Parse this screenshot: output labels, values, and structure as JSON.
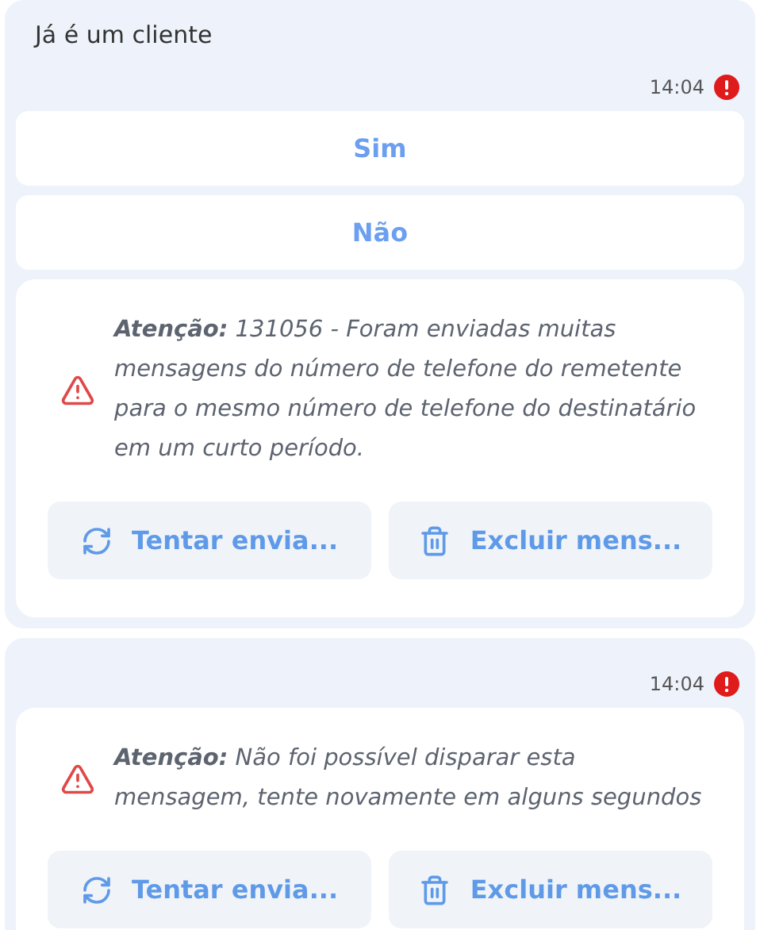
{
  "messages": [
    {
      "text": "Já é um cliente",
      "time": "14:04",
      "error": true,
      "options": [
        "Sim",
        "Não"
      ],
      "alert": {
        "text": "**Atenção:** 131056 - Foram enviadas muitas mensagens do número de telefone do remetente para o mesmo número de telefone do destinatário em um curto período.",
        "actions": [
          {
            "kind": "retry",
            "label": "Tentar envia..."
          },
          {
            "kind": "delete",
            "label": "Excluir mens..."
          }
        ]
      }
    },
    {
      "time": "14:04",
      "error": true,
      "alert": {
        "text": "**Atenção:** Não foi possível disparar esta mensagem, tente novamente em alguns segundos",
        "actions": [
          {
            "kind": "retry",
            "label": "Tentar envia..."
          },
          {
            "kind": "delete",
            "label": "Excluir mens..."
          }
        ]
      }
    }
  ]
}
